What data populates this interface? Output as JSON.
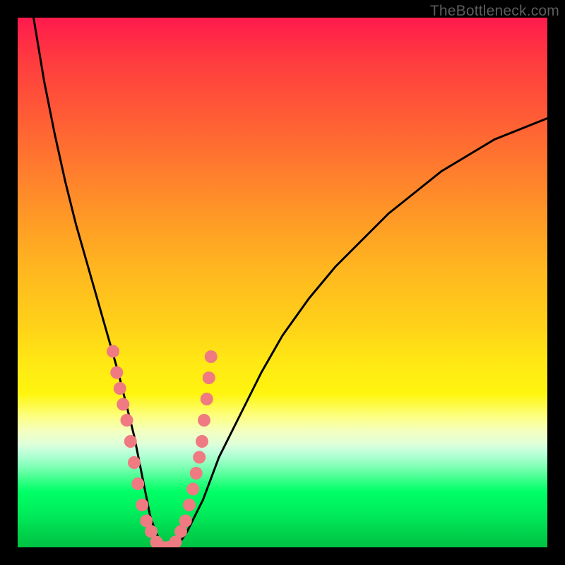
{
  "watermark": "TheBottleneck.com",
  "colors": {
    "marker": "#ef7a81",
    "curve": "#000000",
    "frame": "#000000"
  },
  "chart_data": {
    "type": "line",
    "title": "",
    "xlabel": "",
    "ylabel": "",
    "xlim": [
      0,
      100
    ],
    "ylim": [
      0,
      100
    ],
    "grid": false,
    "legend": false,
    "series": [
      {
        "name": "bottleneck-curve",
        "x": [
          3,
          5,
          7,
          9,
          11,
          13,
          15,
          17,
          19,
          20,
          21,
          22,
          23,
          24,
          25,
          26,
          27,
          28,
          30,
          32,
          35,
          38,
          42,
          46,
          50,
          55,
          60,
          65,
          70,
          75,
          80,
          85,
          90,
          95,
          100
        ],
        "y": [
          100,
          88,
          78,
          69,
          61,
          54,
          47,
          40,
          33,
          29,
          25,
          21,
          16,
          11,
          6,
          3,
          1,
          0,
          0,
          3,
          9,
          17,
          25,
          33,
          40,
          47,
          53,
          58,
          63,
          67,
          71,
          74,
          77,
          79,
          81
        ]
      }
    ],
    "markers": {
      "name": "data-points",
      "points": [
        {
          "x": 18.0,
          "y": 37
        },
        {
          "x": 18.7,
          "y": 33
        },
        {
          "x": 19.3,
          "y": 30
        },
        {
          "x": 19.9,
          "y": 27
        },
        {
          "x": 20.6,
          "y": 24
        },
        {
          "x": 21.3,
          "y": 20
        },
        {
          "x": 22.0,
          "y": 16
        },
        {
          "x": 22.7,
          "y": 12
        },
        {
          "x": 23.5,
          "y": 8
        },
        {
          "x": 24.3,
          "y": 5
        },
        {
          "x": 25.2,
          "y": 3
        },
        {
          "x": 26.2,
          "y": 1
        },
        {
          "x": 27.3,
          "y": 0
        },
        {
          "x": 28.5,
          "y": 0
        },
        {
          "x": 29.8,
          "y": 1
        },
        {
          "x": 30.8,
          "y": 3
        },
        {
          "x": 31.7,
          "y": 5
        },
        {
          "x": 32.4,
          "y": 8
        },
        {
          "x": 33.1,
          "y": 11
        },
        {
          "x": 33.7,
          "y": 14
        },
        {
          "x": 34.3,
          "y": 17
        },
        {
          "x": 34.8,
          "y": 20
        },
        {
          "x": 35.2,
          "y": 24
        },
        {
          "x": 35.7,
          "y": 28
        },
        {
          "x": 36.1,
          "y": 32
        },
        {
          "x": 36.5,
          "y": 36
        }
      ]
    }
  }
}
